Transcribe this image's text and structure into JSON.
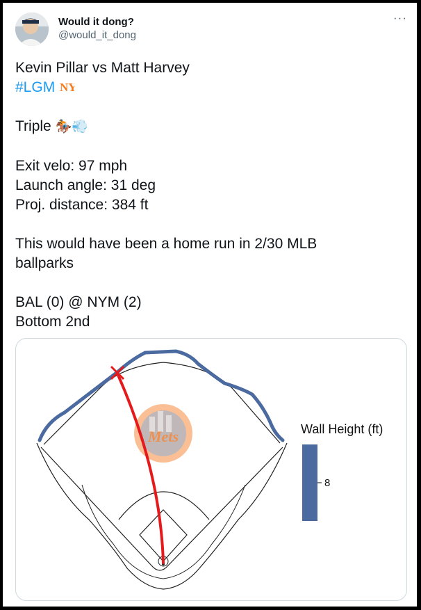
{
  "tweet": {
    "display_name": "Would it dong?",
    "handle": "@would_it_dong",
    "more_label": "···",
    "lines": {
      "matchup": "Kevin Pillar vs Matt Harvey",
      "hashtag": "#LGM",
      "team_emoji": "NY",
      "result": "Triple",
      "result_emojis": "🏇💨",
      "exit_velo": "Exit velo: 97 mph",
      "launch_angle": "Launch angle: 31 deg",
      "distance": "Proj. distance: 384 ft",
      "summary": "This would have been a home run in 2/30 MLB ballparks",
      "score": "BAL (0) @ NYM (2)",
      "inning": "Bottom 2nd"
    }
  },
  "chart": {
    "legend_title": "Wall Height (ft)",
    "legend_value": "8",
    "logo_text": "Mets",
    "wall_color": "#4a6aa0",
    "trajectory_color": "#e41a1c",
    "logo_orange": "#f58a3d"
  }
}
